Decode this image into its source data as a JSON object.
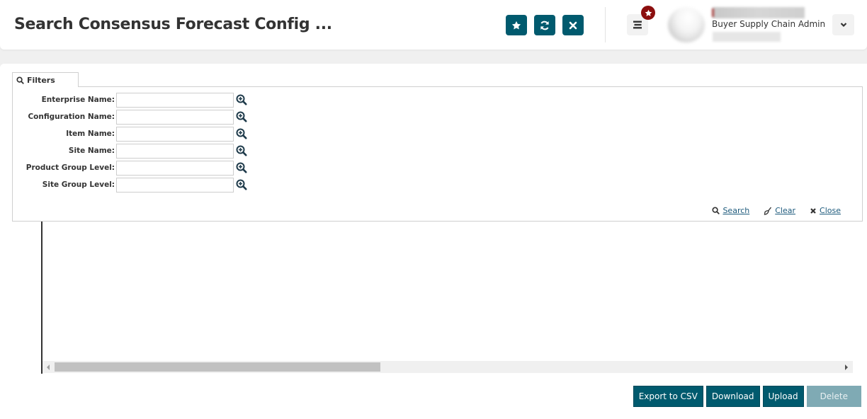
{
  "header": {
    "title": "Search Consensus Forecast Config ...",
    "actions": [
      {
        "name": "favorite",
        "icon": "star-icon"
      },
      {
        "name": "refresh",
        "icon": "refresh-icon"
      },
      {
        "name": "close",
        "icon": "close-icon"
      }
    ],
    "menu_icon": "hamburger-menu-icon",
    "notification_badge_icon": "star-icon",
    "user": {
      "role": "Buyer Supply Chain Admin"
    },
    "dropdown_icon": "chevron-down-icon"
  },
  "filters": {
    "tab_label": "Filters",
    "fields": [
      {
        "label": "Enterprise Name:",
        "value": ""
      },
      {
        "label": "Configuration Name:",
        "value": ""
      },
      {
        "label": "Item Name:",
        "value": ""
      },
      {
        "label": "Site Name:",
        "value": ""
      },
      {
        "label": "Product Group Level:",
        "value": ""
      },
      {
        "label": "Site Group Level:",
        "value": ""
      }
    ],
    "actions": {
      "search": "Search",
      "clear": "Clear",
      "close": "Close"
    }
  },
  "footer": {
    "export_csv": "Export to CSV",
    "download": "Download",
    "upload": "Upload",
    "delete": "Delete"
  },
  "colors": {
    "primary": "#005a6e",
    "primary_disabled": "#7faab4",
    "badge": "#8b0e0e",
    "link": "#1d5a7c"
  }
}
